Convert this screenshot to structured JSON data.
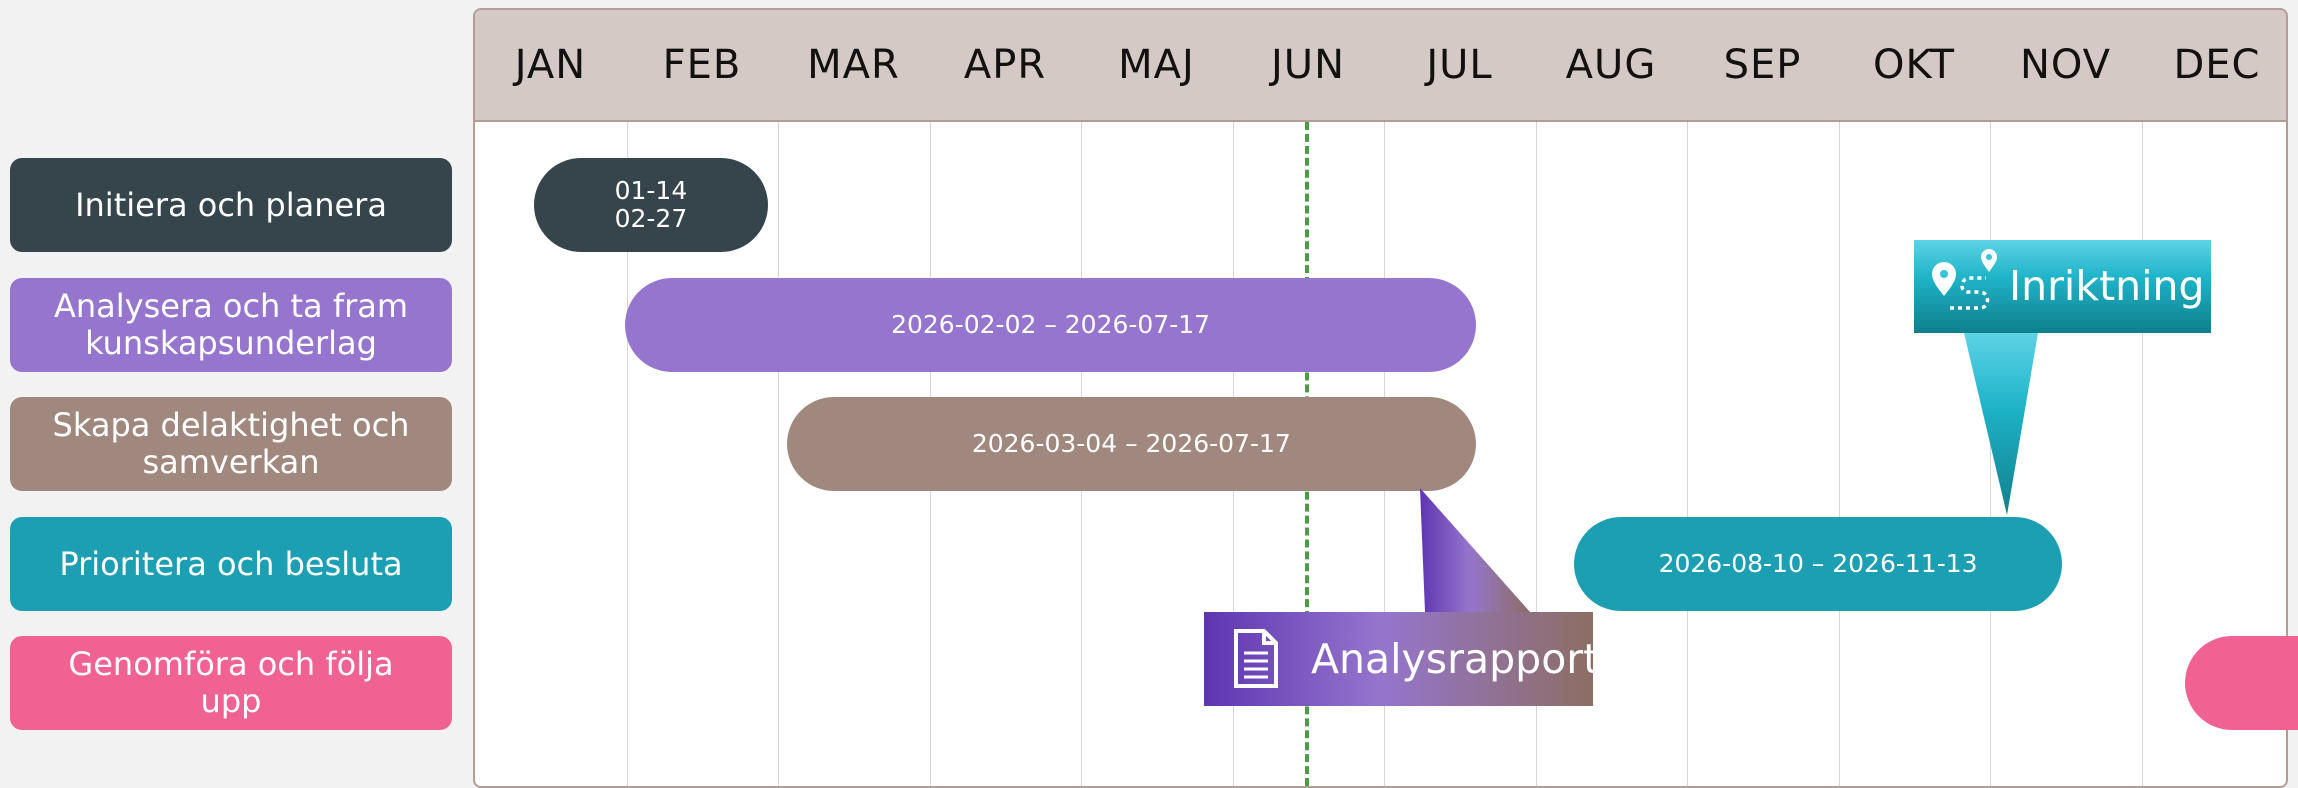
{
  "chart_data": {
    "type": "gantt",
    "months": [
      "JAN",
      "FEB",
      "MAR",
      "APR",
      "MAJ",
      "JUN",
      "JUL",
      "AUG",
      "SEP",
      "OKT",
      "NOV",
      "DEC"
    ],
    "tasks": [
      {
        "label": "Initiera och planera",
        "color": "#36444c",
        "start": "01-14",
        "end": "02-27",
        "bar_text": "01-14\n02-27"
      },
      {
        "label": "Analysera och ta fram\nkunskapsunderlag",
        "color": "#9575cd",
        "start": "2026-02-02",
        "end": "2026-07-17",
        "bar_text": "2026-02-02 – 2026-07-17"
      },
      {
        "label": "Skapa delaktighet och\nsamverkan",
        "color": "#a1887f",
        "start": "2026-03-04",
        "end": "2026-07-17",
        "bar_text": "2026-03-04 – 2026-07-17"
      },
      {
        "label": "Prioritera och besluta",
        "color": "#1d9fb3",
        "start": "2026-08-10",
        "end": "2026-11-13",
        "bar_text": "2026-08-10 – 2026-11-13"
      },
      {
        "label": "Genomföra och följa\nupp",
        "color": "#f06292",
        "start": "2026-12-21",
        "end": "",
        "bar_text": ""
      }
    ],
    "today": "2026-06-16",
    "milestones": [
      {
        "label": "Analysrapport",
        "icon": "document-icon",
        "date": "2026-07-17",
        "colors": [
          "#5e35b1",
          "#9575cd",
          "#8d6e63"
        ]
      },
      {
        "label": "Inriktning",
        "icon": "route-pin-icon",
        "date": "2026-11-13",
        "colors": [
          "#5ed3e6",
          "#1fb4c9",
          "#0f7f8c"
        ]
      }
    ],
    "colors": {
      "panel_header": "#d5c9c5",
      "panel_border": "#b39c94",
      "today_line": "#4a9d44",
      "grid": "#d6d6d6"
    }
  }
}
